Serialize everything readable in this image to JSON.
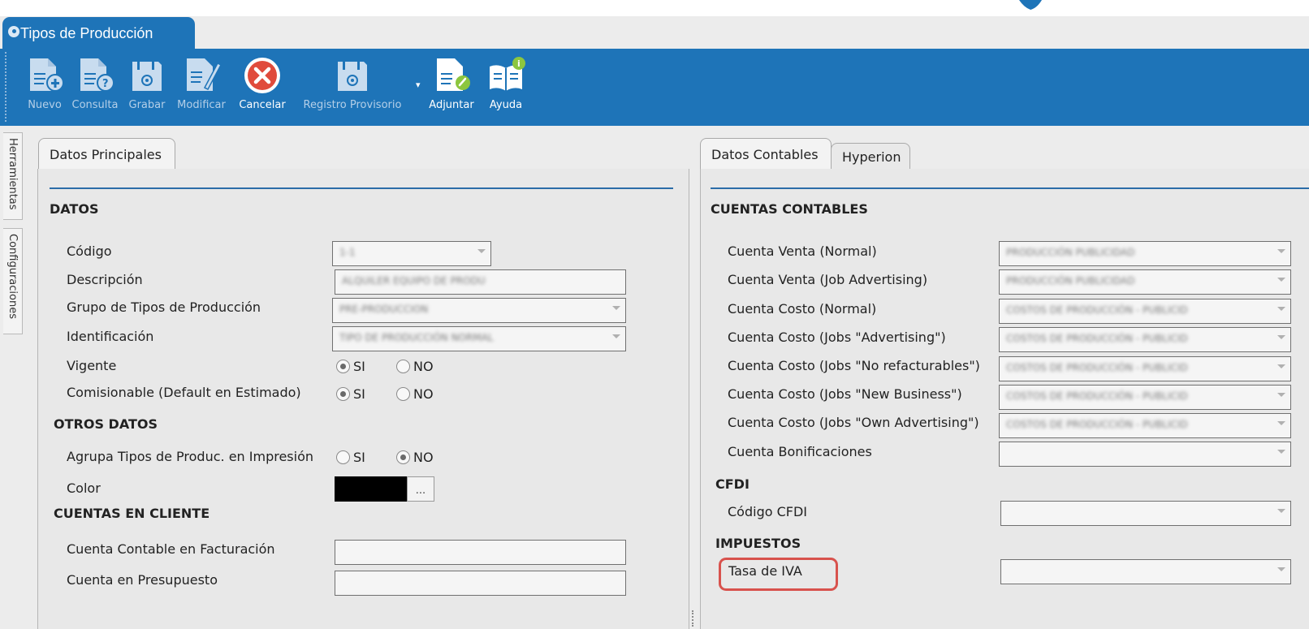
{
  "window": {
    "tab_title": "Tipos de Producción"
  },
  "toolbar": {
    "buttons": [
      {
        "label": "Nuevo",
        "icon": "new-document-icon",
        "active": false
      },
      {
        "label": "Consulta",
        "icon": "query-document-icon",
        "active": false
      },
      {
        "label": "Grabar",
        "icon": "save-disk-icon",
        "active": false
      },
      {
        "label": "Modificar",
        "icon": "edit-document-icon",
        "active": false
      },
      {
        "label": "Cancelar",
        "icon": "cancel-icon",
        "active": true
      },
      {
        "label": "Registro Provisorio",
        "icon": "provisional-save-icon",
        "active": false
      },
      {
        "label": "Adjuntar",
        "icon": "attach-icon",
        "active": true
      },
      {
        "label": "Ayuda",
        "icon": "help-book-icon",
        "active": true
      }
    ]
  },
  "side_tabs": [
    "Herramientas",
    "Configuraciones"
  ],
  "left_panel": {
    "tab": "Datos Principales",
    "sections": {
      "datos": "DATOS",
      "otros": "OTROS DATOS",
      "cuentas_cliente": "CUENTAS EN CLIENTE"
    },
    "fields": {
      "codigo": {
        "label": "Código",
        "value": "1-1"
      },
      "descripcion": {
        "label": "Descripción",
        "value": "ALQUILER EQUIPO DE PRODU"
      },
      "grupo": {
        "label": "Grupo de Tipos de Producción",
        "value": "PRE-PRODUCCION"
      },
      "identificacion": {
        "label": "Identificación",
        "value": "TIPO DE PRODUCCIÓN NORMAL"
      },
      "vigente": {
        "label": "Vigente",
        "selected": "SI"
      },
      "comisionable": {
        "label": "Comisionable (Default en Estimado)",
        "selected": "SI"
      },
      "agrupa": {
        "label": "Agrupa Tipos de Produc. en Impresión",
        "selected": "NO"
      },
      "color": {
        "label": "Color",
        "value": "#000000",
        "button": "..."
      },
      "cuenta_facturacion": {
        "label": "Cuenta Contable en Facturación",
        "value": ""
      },
      "cuenta_presupuesto": {
        "label": "Cuenta en Presupuesto",
        "value": ""
      }
    },
    "radio_labels": {
      "yes": "SI",
      "no": "NO"
    }
  },
  "right_panel": {
    "tabs": [
      "Datos Contables",
      "Hyperion"
    ],
    "sections": {
      "cuentas_contables": "CUENTAS CONTABLES",
      "cfdi": "CFDI",
      "impuestos": "IMPUESTOS"
    },
    "fields": [
      {
        "label": "Cuenta Venta (Normal)",
        "value": "PRODUCCIÓN PUBLICIDAD"
      },
      {
        "label": "Cuenta Venta (Job Advertising)",
        "value": "PRODUCCIÓN PUBLICIDAD"
      },
      {
        "label": "Cuenta Costo (Normal)",
        "value": "COSTOS DE PRODUCCIÓN - PUBLICID"
      },
      {
        "label": "Cuenta Costo (Jobs \"Advertising\")",
        "value": "COSTOS DE PRODUCCIÓN - PUBLICID"
      },
      {
        "label": "Cuenta Costo (Jobs \"No refacturables\")",
        "value": "COSTOS DE PRODUCCIÓN - PUBLICID"
      },
      {
        "label": "Cuenta Costo (Jobs \"New Business\")",
        "value": "COSTOS DE PRODUCCIÓN - PUBLICID"
      },
      {
        "label": "Cuenta Costo (Jobs \"Own Advertising\")",
        "value": "COSTOS DE PRODUCCIÓN - PUBLICID"
      },
      {
        "label": "Cuenta Bonificaciones",
        "value": ""
      }
    ],
    "codigo_cfdi": {
      "label": "Código CFDI",
      "value": ""
    },
    "tasa_iva": {
      "label": "Tasa de IVA",
      "value": ""
    }
  },
  "colors": {
    "accent": "#1e74b8",
    "highlight": "#d8524d",
    "cancel": "#e04b3c"
  }
}
